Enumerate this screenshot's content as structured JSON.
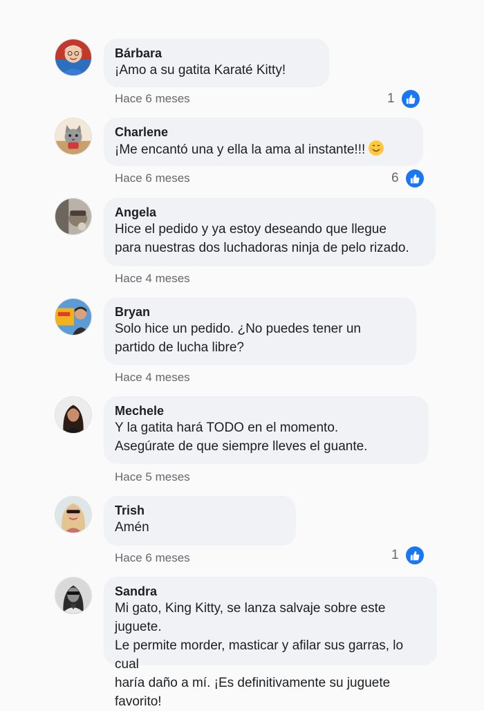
{
  "time_label_prefix": "Hace",
  "comments": [
    {
      "name": "Bárbara",
      "text": "¡Amo a su gatita Karaté Kitty!",
      "time": "Hace 6 meses",
      "likes": "1",
      "avatar_icon": "elderly-woman-avatar"
    },
    {
      "name": "Charlene",
      "text": "¡Me encantó una y ella la ama al instante!!!",
      "emoji": "smiling-face-emoji",
      "time": "Hace 6 meses",
      "likes": "6",
      "avatar_icon": "cat-avatar"
    },
    {
      "name": "Angela",
      "text": "Hice el pedido y ya estoy deseando que llegue\npara nuestras dos luchadoras ninja de pelo rizado.",
      "time": "Hace 4 meses",
      "likes": "",
      "avatar_icon": "photo-avatar"
    },
    {
      "name": "Bryan",
      "text": "Solo hice un pedido.  ¿No puedes tener un\npartido de lucha libre?",
      "time": "Hace 4 meses",
      "likes": "",
      "avatar_icon": "man-avatar"
    },
    {
      "name": "Mechele",
      "text": "Y la gatita hará TODO en el momento.\nAsegúrate de que siempre lleves el guante.",
      "time": "Hace 5 meses",
      "likes": "",
      "avatar_icon": "woman-avatar"
    },
    {
      "name": "Trish",
      "text": "Amén",
      "time": "Hace 6 meses",
      "likes": "1",
      "avatar_icon": "blonde-woman-avatar"
    },
    {
      "name": "Sandra",
      "text": "Mi gato, King Kitty, se lanza salvaje sobre este juguete.\nLe permite morder, masticar y afilar sus garras, lo cual\nharía daño a mí. ¡Es definitivamente su juguete favorito!",
      "time": "",
      "likes": "",
      "avatar_icon": "woman-sunglasses-avatar"
    }
  ],
  "colors": {
    "background": "#fafafa",
    "bubble": "#f0f2f5",
    "like_blue": "#1877f2",
    "meta_gray": "#65676b"
  }
}
